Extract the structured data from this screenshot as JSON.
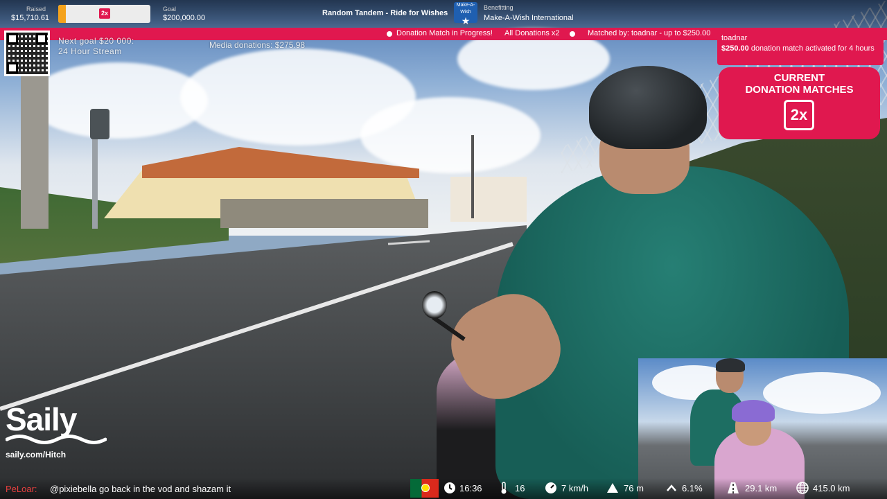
{
  "stream_header": {
    "raised_label": "Raised",
    "raised_value": "$15,710.61",
    "progress_fraction": 0.08,
    "multiplier_badge": "2x",
    "goal_label": "Goal",
    "goal_value": "$200,000.00",
    "event_title": "Random Tandem - Ride for Wishes",
    "charity_logo_text": "Make-A-Wish",
    "benefitting_label": "Benefitting",
    "charity_name": "Make-A-Wish International"
  },
  "ticker": {
    "item1": "Donation Match in Progress!",
    "item2": "All Donations x2",
    "item3": "Matched by:  toadnar - up to $250.00"
  },
  "overlay": {
    "next_goal_line1": "Next goal $20 000:",
    "next_goal_line2": "24 Hour Stream",
    "media_donations": "Media donations: $275.98"
  },
  "alert": {
    "user": "toadnar",
    "amount": "$250.00",
    "message": " donation match activated for 4 hours"
  },
  "matches_card": {
    "title_line1": "CURRENT",
    "title_line2": "DONATION MATCHES",
    "multiplier": "2x"
  },
  "sponsor": {
    "name": "Saily",
    "url": "saily.com/Hitch"
  },
  "chat": {
    "user": "PeLoar:",
    "message": "@pixiebella go back in the vod and shazam it"
  },
  "telemetry": {
    "time": "16:36",
    "temperature": "16",
    "speed": "7 km/h",
    "elevation": "76 m",
    "grade": "6.1%",
    "distance": "29.1 km",
    "total_distance": "415.0 km"
  },
  "icons": {
    "clock": "clock-icon",
    "thermometer": "thermometer-icon",
    "speedometer": "speedometer-icon",
    "mountain": "mountain-icon",
    "grade": "chevron-up-icon",
    "road": "road-icon",
    "globe": "globe-icon"
  },
  "colors": {
    "accent": "#e0184f",
    "progress": "#f4a21c"
  }
}
